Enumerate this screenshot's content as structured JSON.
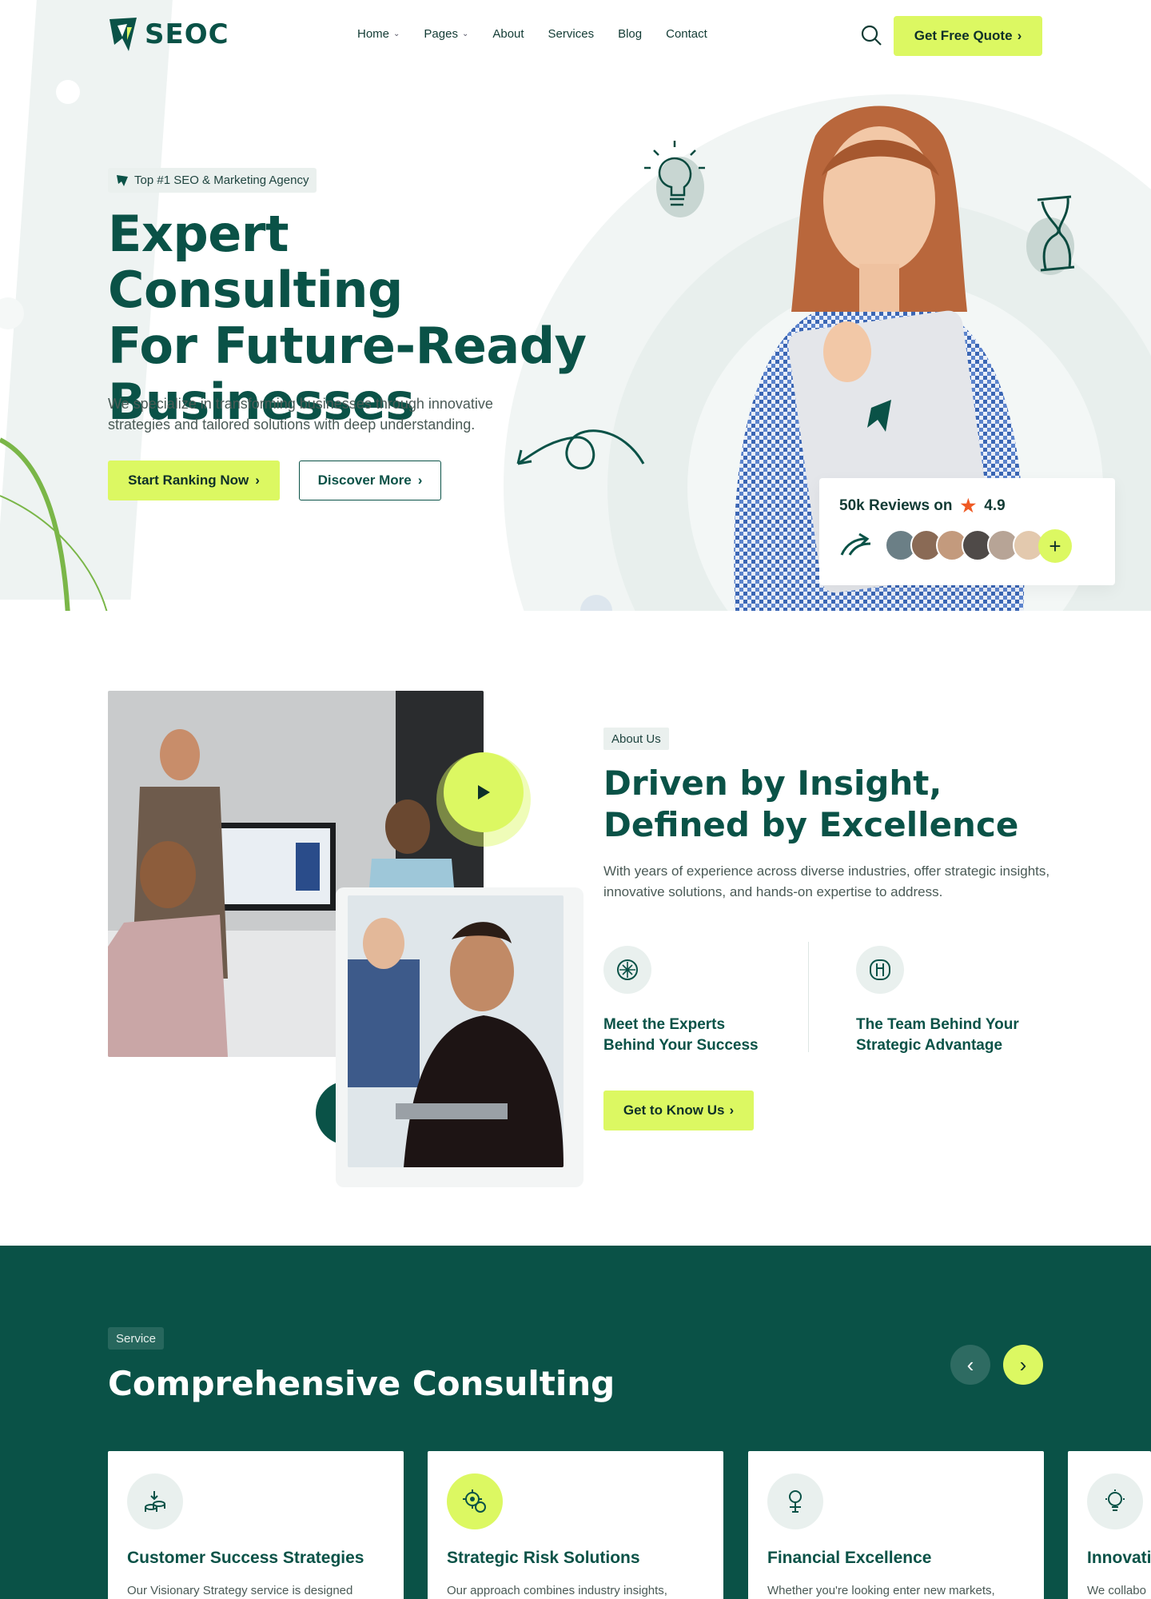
{
  "brand": {
    "name": "SEOC"
  },
  "nav": {
    "items": [
      {
        "label": "Home",
        "dropdown": true
      },
      {
        "label": "Pages",
        "dropdown": true
      },
      {
        "label": "About",
        "dropdown": false
      },
      {
        "label": "Services",
        "dropdown": false
      },
      {
        "label": "Blog",
        "dropdown": false
      },
      {
        "label": "Contact",
        "dropdown": false
      }
    ],
    "cta": "Get Free Quote"
  },
  "hero": {
    "badge": "Top #1 SEO & Marketing Agency",
    "title_line1": "Expert Consulting",
    "title_line2": "For Future-Ready",
    "title_line3": "Businesses",
    "description": "We specialize in transforming businesses through innovative strategies and tailored solutions with deep understanding.",
    "btn_primary": "Start Ranking Now",
    "btn_secondary": "Discover More",
    "reviews_label": "50k Reviews on",
    "rating": "4.9"
  },
  "about": {
    "tag": "About Us",
    "title": "Driven by Insight, Defined by Excellence",
    "description": "With years of experience across diverse industries, offer strategic insights, innovative solutions, and hands-on expertise to address.",
    "features": [
      {
        "text": "Meet the Experts Behind Your Success",
        "icon": "brain-icon"
      },
      {
        "text": "The Team Behind Your Strategic Advantage",
        "icon": "team-icon"
      }
    ],
    "cta": "Get to Know Us"
  },
  "services": {
    "tag": "Service",
    "title": "Comprehensive Consulting",
    "cards": [
      {
        "title": "Customer Success Strategies",
        "desc": "Our Visionary Strategy service is designed",
        "icon": "coins-icon"
      },
      {
        "title": "Strategic Risk Solutions",
        "desc": "Our approach combines industry insights,",
        "icon": "gear-chart-icon"
      },
      {
        "title": "Financial Excellence",
        "desc": "Whether you're looking enter new markets,",
        "icon": "magnifier-icon"
      },
      {
        "title": "Innovati",
        "desc": "We collabo",
        "icon": "bulb-icon"
      }
    ]
  },
  "colors": {
    "primary": "#0a5247",
    "accent": "#dcf862",
    "star": "#ef5a24"
  }
}
